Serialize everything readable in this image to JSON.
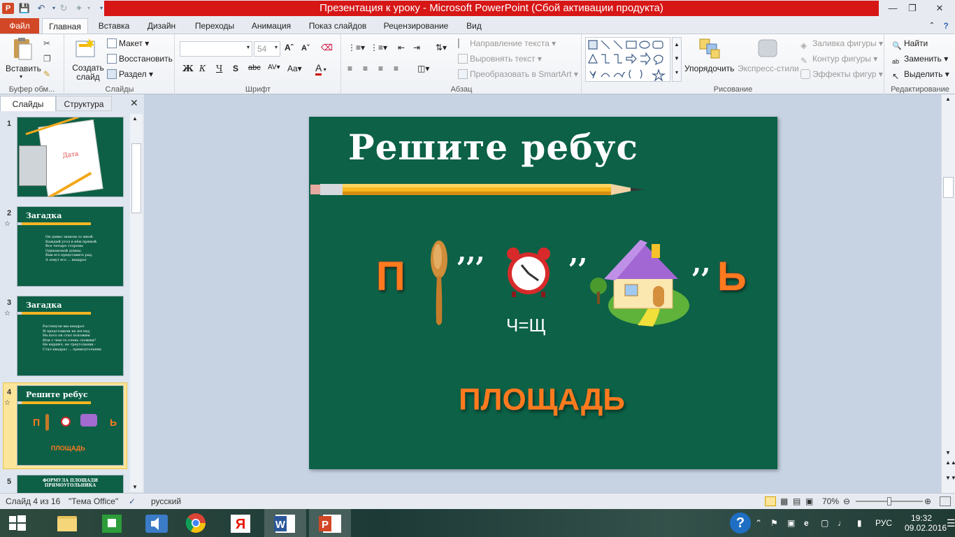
{
  "window": {
    "title": "Презентация к уроку  -  Microsoft PowerPoint (Сбой активации продукта)"
  },
  "tabs": {
    "file": "Файл",
    "items": [
      "Главная",
      "Вставка",
      "Дизайн",
      "Переходы",
      "Анимация",
      "Показ слайдов",
      "Рецензирование",
      "Вид"
    ]
  },
  "ribbon": {
    "clipboard": {
      "paste": "Вставить",
      "label": "Буфер обм..."
    },
    "slides": {
      "new_slide": "Создать слайд",
      "layout": "Макет",
      "reset": "Восстановить",
      "section": "Раздел",
      "label": "Слайды"
    },
    "font": {
      "size": "54",
      "label": "Шрифт"
    },
    "paragraph": {
      "text_direction": "Направление текста",
      "align_text": "Выровнять текст",
      "smartart": "Преобразовать в SmartArt",
      "label": "Абзац"
    },
    "drawing": {
      "arrange": "Упорядочить",
      "quick_styles": "Экспресс-стили",
      "fill": "Заливка фигуры",
      "outline": "Контур фигуры",
      "effects": "Эффекты фигур",
      "label": "Рисование"
    },
    "editing": {
      "find": "Найти",
      "replace": "Заменить",
      "select": "Выделить",
      "label": "Редактирование"
    }
  },
  "left_panel": {
    "tab_slides": "Слайды",
    "tab_outline": "Структура",
    "thumbs": [
      {
        "num": "1",
        "title": "",
        "badge": "Дата"
      },
      {
        "num": "2",
        "title": "Загадка",
        "lines": [
          "Он давно знаком со мной.",
          "Каждый угол в нём прямой.",
          "Все четыре стороны",
          "Одинаковой длины.",
          "Вам его представить рад,",
          "А зовут его ... квадрат"
        ]
      },
      {
        "num": "3",
        "title": "Загадка",
        "lines": [
          "Растянули мы квадрат",
          "И представили на взгляд,",
          "На кого он стал похожим",
          "Или с чем-то очень схожим?",
          "Не кирпич, не треугольник -",
          "Стал квадрат ... прямоугольник"
        ]
      },
      {
        "num": "4",
        "title": "Решите ребус",
        "answer": "ПЛОЩАДЬ"
      },
      {
        "num": "5",
        "title": "ФОРМУЛА ПЛОЩАДИ ПРЯМОУГОЛЬНИКА"
      }
    ]
  },
  "slide": {
    "title": "Решите ребус",
    "letter_p": "П",
    "commas_1": ",,,",
    "commas_2": ",,",
    "commas_3": ",,",
    "letter_soft": "Ь",
    "rule": "Ч=Щ",
    "answer": "ПЛОЩАДЬ"
  },
  "status": {
    "slide_info": "Слайд 4 из 16",
    "theme": "\"Тема Office\"",
    "language": "русский",
    "zoom": "70%",
    "zoom_level": 0.5
  },
  "taskbar": {
    "language": "РУС",
    "time": "19:32",
    "date": "09.02.2016"
  },
  "colors": {
    "slide_bg": "#0c6147",
    "accent_orange": "#ff7a1e",
    "title_bar_red": "#d71616",
    "file_tab": "#d24726"
  }
}
